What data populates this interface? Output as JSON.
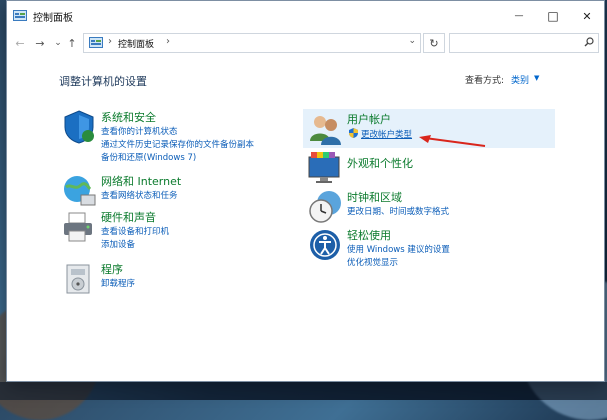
{
  "window": {
    "title": "控制面板",
    "controls": {
      "minimize": "—",
      "maximize": "□",
      "close": "✕"
    }
  },
  "nav": {
    "back": "←",
    "forward": "→",
    "recent": "⌄",
    "up": "↑",
    "refresh": "↻"
  },
  "address": {
    "separator": "›",
    "path": "控制面板",
    "dropdown": "⌄"
  },
  "search": {
    "placeholder": ""
  },
  "header": {
    "title": "调整计算机的设置",
    "view_by_label": "查看方式:",
    "view_by_value": "类别",
    "view_by_caret": "▼"
  },
  "categories": {
    "system_security": {
      "title": "系统和安全",
      "links": [
        "查看你的计算机状态",
        "通过文件历史记录保存你的文件备份副本",
        "备份和还原(Windows 7)"
      ]
    },
    "network": {
      "title": "网络和 Internet",
      "links": [
        "查看网络状态和任务"
      ]
    },
    "hardware": {
      "title": "硬件和声音",
      "links": [
        "查看设备和打印机",
        "添加设备"
      ]
    },
    "programs": {
      "title": "程序",
      "links": [
        "卸载程序"
      ]
    },
    "user_accounts": {
      "title": "用户帐户",
      "links": [
        "更改帐户类型"
      ]
    },
    "appearance": {
      "title": "外观和个性化",
      "links": []
    },
    "clock_region": {
      "title": "时钟和区域",
      "links": [
        "更改日期、时间或数字格式"
      ]
    },
    "ease_of_access": {
      "title": "轻松使用",
      "links": [
        "使用 Windows 建议的设置",
        "优化视觉显示"
      ]
    }
  },
  "colors": {
    "category_title": "#0a7a2c",
    "link": "#0b5db8",
    "highlight": "#e5f1fb",
    "annotation_arrow": "#d9261c"
  }
}
